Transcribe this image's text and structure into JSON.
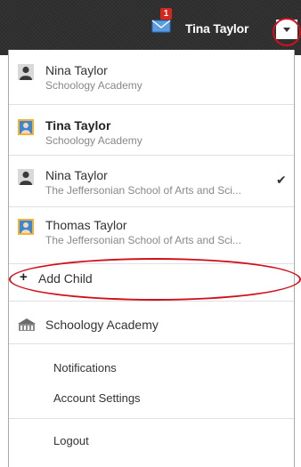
{
  "header": {
    "notification_count": "1",
    "user_name": "Tina Taylor"
  },
  "accounts": [
    {
      "name": "Nina Taylor",
      "school": "Schoology Academy",
      "avatar": "person-silhouette-icon",
      "selected": false
    },
    {
      "name": "Tina Taylor",
      "school": "Schoology Academy",
      "avatar": "parent-account-icon",
      "selected": true
    },
    {
      "name": "Nina Taylor",
      "school": "The Jeffersonian School of Arts and Sci...",
      "avatar": "person-silhouette-icon",
      "selected": false
    },
    {
      "name": "Thomas Taylor",
      "school": "The Jeffersonian School of Arts and Sci...",
      "avatar": "parent-account-icon",
      "selected": false
    }
  ],
  "add_child": {
    "icon": "+",
    "label": "Add Child"
  },
  "school_link": {
    "label": "Schoology Academy",
    "icon": "school-building-icon"
  },
  "menu": {
    "notifications": "Notifications",
    "account_settings": "Account Settings",
    "logout": "Logout"
  },
  "colors": {
    "header_bg": "#2f2f2f",
    "badge": "#d9261c",
    "annotation": "#d0111b",
    "mail_icon": "#4a90d9"
  }
}
